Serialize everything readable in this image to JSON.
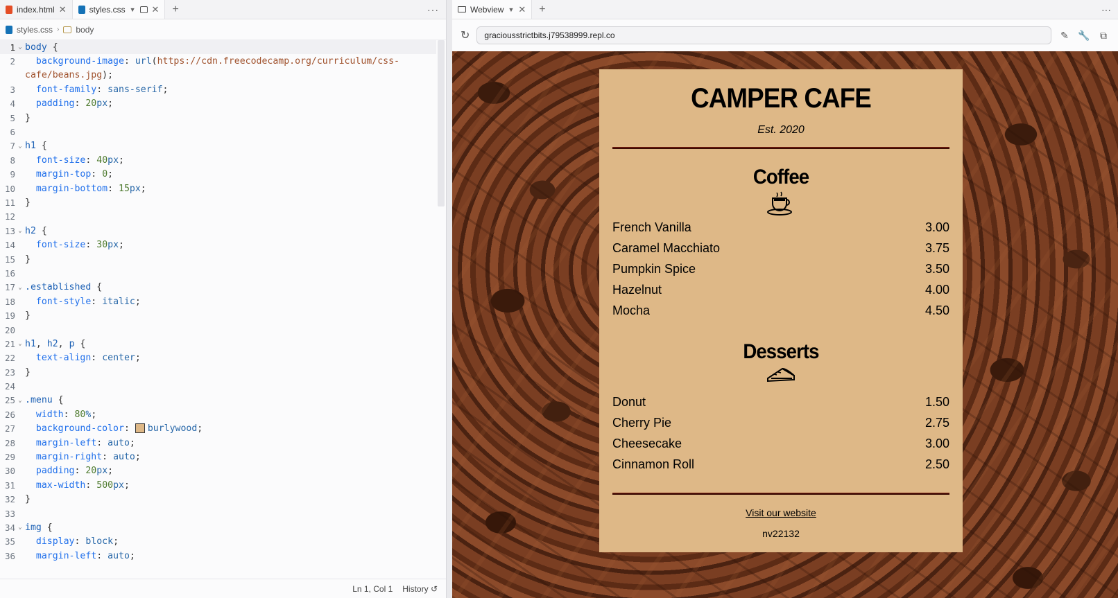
{
  "editor": {
    "tabs": [
      {
        "label": "index.html",
        "icon": "html-file-icon"
      },
      {
        "label": "styles.css",
        "icon": "css-file-icon"
      }
    ],
    "breadcrumb": {
      "file": "styles.css",
      "element": "body"
    },
    "status": {
      "position": "Ln 1, Col 1",
      "history": "History"
    },
    "lines": [
      {
        "n": "1",
        "fold": true,
        "segs": [
          [
            "t-sel",
            "body"
          ],
          [
            "t-p",
            " {"
          ]
        ]
      },
      {
        "n": "2",
        "segs": [
          [
            "t-p",
            "  "
          ],
          [
            "t-prop",
            "background-image"
          ],
          [
            "t-p",
            ": "
          ],
          [
            "t-val",
            "url"
          ],
          [
            "t-p",
            "("
          ],
          [
            "t-str",
            "https://cdn.freecodecamp.org/curriculum/css-"
          ]
        ]
      },
      {
        "n": "",
        "segs": [
          [
            "t-str",
            "cafe/beans.jpg"
          ],
          [
            "t-p",
            ");"
          ]
        ]
      },
      {
        "n": "3",
        "segs": [
          [
            "t-p",
            "  "
          ],
          [
            "t-prop",
            "font-family"
          ],
          [
            "t-p",
            ": "
          ],
          [
            "t-val",
            "sans-serif"
          ],
          [
            "t-p",
            ";"
          ]
        ]
      },
      {
        "n": "4",
        "segs": [
          [
            "t-p",
            "  "
          ],
          [
            "t-prop",
            "padding"
          ],
          [
            "t-p",
            ": "
          ],
          [
            "t-num",
            "20"
          ],
          [
            "t-val",
            "px"
          ],
          [
            "t-p",
            ";"
          ]
        ]
      },
      {
        "n": "5",
        "segs": [
          [
            "t-p",
            "}"
          ]
        ]
      },
      {
        "n": "6",
        "segs": []
      },
      {
        "n": "7",
        "fold": true,
        "segs": [
          [
            "t-sel",
            "h1"
          ],
          [
            "t-p",
            " {"
          ]
        ]
      },
      {
        "n": "8",
        "segs": [
          [
            "t-p",
            "  "
          ],
          [
            "t-prop",
            "font-size"
          ],
          [
            "t-p",
            ": "
          ],
          [
            "t-num",
            "40"
          ],
          [
            "t-val",
            "px"
          ],
          [
            "t-p",
            ";"
          ]
        ]
      },
      {
        "n": "9",
        "segs": [
          [
            "t-p",
            "  "
          ],
          [
            "t-prop",
            "margin-top"
          ],
          [
            "t-p",
            ": "
          ],
          [
            "t-num",
            "0"
          ],
          [
            "t-p",
            ";"
          ]
        ]
      },
      {
        "n": "10",
        "segs": [
          [
            "t-p",
            "  "
          ],
          [
            "t-prop",
            "margin-bottom"
          ],
          [
            "t-p",
            ": "
          ],
          [
            "t-num",
            "15"
          ],
          [
            "t-val",
            "px"
          ],
          [
            "t-p",
            ";"
          ]
        ]
      },
      {
        "n": "11",
        "segs": [
          [
            "t-p",
            "}"
          ]
        ]
      },
      {
        "n": "12",
        "segs": []
      },
      {
        "n": "13",
        "fold": true,
        "segs": [
          [
            "t-sel",
            "h2"
          ],
          [
            "t-p",
            " {"
          ]
        ]
      },
      {
        "n": "14",
        "segs": [
          [
            "t-p",
            "  "
          ],
          [
            "t-prop",
            "font-size"
          ],
          [
            "t-p",
            ": "
          ],
          [
            "t-num",
            "30"
          ],
          [
            "t-val",
            "px"
          ],
          [
            "t-p",
            ";"
          ]
        ]
      },
      {
        "n": "15",
        "segs": [
          [
            "t-p",
            "}"
          ]
        ]
      },
      {
        "n": "16",
        "segs": []
      },
      {
        "n": "17",
        "fold": true,
        "segs": [
          [
            "t-sel",
            ".established"
          ],
          [
            "t-p",
            " {"
          ]
        ]
      },
      {
        "n": "18",
        "segs": [
          [
            "t-p",
            "  "
          ],
          [
            "t-prop",
            "font-style"
          ],
          [
            "t-p",
            ": "
          ],
          [
            "t-val",
            "italic"
          ],
          [
            "t-p",
            ";"
          ]
        ]
      },
      {
        "n": "19",
        "segs": [
          [
            "t-p",
            "}"
          ]
        ]
      },
      {
        "n": "20",
        "segs": []
      },
      {
        "n": "21",
        "fold": true,
        "segs": [
          [
            "t-sel",
            "h1"
          ],
          [
            "t-p",
            ", "
          ],
          [
            "t-sel",
            "h2"
          ],
          [
            "t-p",
            ", "
          ],
          [
            "t-sel",
            "p"
          ],
          [
            "t-p",
            " {"
          ]
        ]
      },
      {
        "n": "22",
        "segs": [
          [
            "t-p",
            "  "
          ],
          [
            "t-prop",
            "text-align"
          ],
          [
            "t-p",
            ": "
          ],
          [
            "t-val",
            "center"
          ],
          [
            "t-p",
            ";"
          ]
        ]
      },
      {
        "n": "23",
        "segs": [
          [
            "t-p",
            "}"
          ]
        ]
      },
      {
        "n": "24",
        "segs": []
      },
      {
        "n": "25",
        "fold": true,
        "segs": [
          [
            "t-sel",
            ".menu"
          ],
          [
            "t-p",
            " {"
          ]
        ]
      },
      {
        "n": "26",
        "segs": [
          [
            "t-p",
            "  "
          ],
          [
            "t-prop",
            "width"
          ],
          [
            "t-p",
            ": "
          ],
          [
            "t-num",
            "80"
          ],
          [
            "t-val",
            "%"
          ],
          [
            "t-p",
            ";"
          ]
        ]
      },
      {
        "n": "27",
        "swatch": true,
        "segs": [
          [
            "t-p",
            "  "
          ],
          [
            "t-prop",
            "background-color"
          ],
          [
            "t-p",
            ": "
          ],
          [
            "swatch",
            ""
          ],
          [
            "t-val",
            "burlywood"
          ],
          [
            "t-p",
            ";"
          ]
        ]
      },
      {
        "n": "28",
        "segs": [
          [
            "t-p",
            "  "
          ],
          [
            "t-prop",
            "margin-left"
          ],
          [
            "t-p",
            ": "
          ],
          [
            "t-val",
            "auto"
          ],
          [
            "t-p",
            ";"
          ]
        ]
      },
      {
        "n": "29",
        "segs": [
          [
            "t-p",
            "  "
          ],
          [
            "t-prop",
            "margin-right"
          ],
          [
            "t-p",
            ": "
          ],
          [
            "t-val",
            "auto"
          ],
          [
            "t-p",
            ";"
          ]
        ]
      },
      {
        "n": "30",
        "segs": [
          [
            "t-p",
            "  "
          ],
          [
            "t-prop",
            "padding"
          ],
          [
            "t-p",
            ": "
          ],
          [
            "t-num",
            "20"
          ],
          [
            "t-val",
            "px"
          ],
          [
            "t-p",
            ";"
          ]
        ]
      },
      {
        "n": "31",
        "segs": [
          [
            "t-p",
            "  "
          ],
          [
            "t-prop",
            "max-width"
          ],
          [
            "t-p",
            ": "
          ],
          [
            "t-num",
            "500"
          ],
          [
            "t-val",
            "px"
          ],
          [
            "t-p",
            ";"
          ]
        ]
      },
      {
        "n": "32",
        "segs": [
          [
            "t-p",
            "}"
          ]
        ]
      },
      {
        "n": "33",
        "segs": []
      },
      {
        "n": "34",
        "fold": true,
        "segs": [
          [
            "t-sel",
            "img"
          ],
          [
            "t-p",
            " {"
          ]
        ]
      },
      {
        "n": "35",
        "segs": [
          [
            "t-p",
            "  "
          ],
          [
            "t-prop",
            "display"
          ],
          [
            "t-p",
            ": "
          ],
          [
            "t-val",
            "block"
          ],
          [
            "t-p",
            ";"
          ]
        ]
      },
      {
        "n": "36",
        "segs": [
          [
            "t-p",
            "  "
          ],
          [
            "t-prop",
            "margin-left"
          ],
          [
            "t-p",
            ": "
          ],
          [
            "t-val",
            "auto"
          ],
          [
            "t-p",
            ";"
          ]
        ]
      }
    ]
  },
  "webview": {
    "tab_label": "Webview",
    "url": "graciousstrictbits.j79538999.repl.co",
    "menu": {
      "title": "CAMPER CAFE",
      "established": "Est. 2020",
      "coffee_heading": "Coffee",
      "coffee": [
        {
          "name": "French Vanilla",
          "price": "3.00"
        },
        {
          "name": "Caramel Macchiato",
          "price": "3.75"
        },
        {
          "name": "Pumpkin Spice",
          "price": "3.50"
        },
        {
          "name": "Hazelnut",
          "price": "4.00"
        },
        {
          "name": "Mocha",
          "price": "4.50"
        }
      ],
      "desserts_heading": "Desserts",
      "desserts": [
        {
          "name": "Donut",
          "price": "1.50"
        },
        {
          "name": "Cherry Pie",
          "price": "2.75"
        },
        {
          "name": "Cheesecake",
          "price": "3.00"
        },
        {
          "name": "Cinnamon Roll",
          "price": "2.50"
        }
      ],
      "footer_link": "Visit our website",
      "footer_id": "nv22132"
    }
  },
  "colors": {
    "menu_bg": "#deb887",
    "hr": "#3b0d06"
  }
}
